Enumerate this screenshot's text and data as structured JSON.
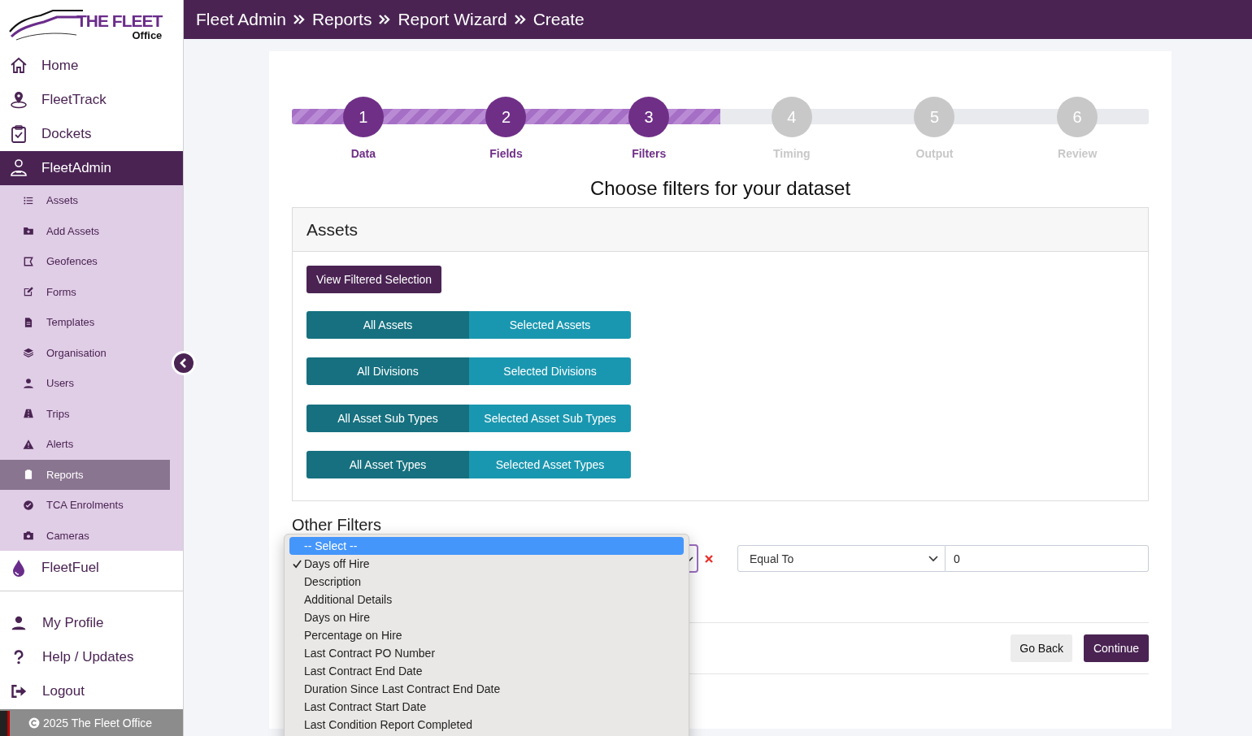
{
  "sidebar": {
    "logo": {
      "title": "THE FLEET",
      "subtitle": "Office"
    },
    "items": [
      {
        "label": "Home",
        "selected": false
      },
      {
        "label": "FleetTrack",
        "selected": false
      },
      {
        "label": "Dockets",
        "selected": false
      },
      {
        "label": "FleetAdmin",
        "selected": true,
        "expanded": true,
        "children": [
          {
            "label": "Assets",
            "selected": false
          },
          {
            "label": "Add Assets",
            "selected": false
          },
          {
            "label": "Geofences",
            "selected": false
          },
          {
            "label": "Forms",
            "selected": false
          },
          {
            "label": "Templates",
            "selected": false
          },
          {
            "label": "Organisation",
            "selected": false
          },
          {
            "label": "Users",
            "selected": false
          },
          {
            "label": "Trips",
            "selected": false
          },
          {
            "label": "Alerts",
            "selected": false
          },
          {
            "label": "Reports",
            "selected": true
          },
          {
            "label": "TCA Enrolments",
            "selected": false
          },
          {
            "label": "Cameras",
            "selected": false
          }
        ]
      },
      {
        "label": "FleetFuel",
        "selected": false
      }
    ],
    "account_items": [
      {
        "label": "My Profile"
      },
      {
        "label": "Help / Updates"
      },
      {
        "label": "Logout"
      }
    ],
    "footer": "2025 The Fleet Office"
  },
  "breadcrumb": [
    "Fleet Admin",
    "Reports",
    "Report Wizard",
    "Create"
  ],
  "wizard": {
    "level": 0.5,
    "steps": [
      {
        "number": "1",
        "label": "Data",
        "active": true
      },
      {
        "number": "2",
        "label": "Fields",
        "active": true
      },
      {
        "number": "3",
        "label": "Filters",
        "active": true
      },
      {
        "number": "4",
        "label": "Timing",
        "active": false
      },
      {
        "number": "5",
        "label": "Output",
        "active": false
      },
      {
        "number": "6",
        "label": "Review",
        "active": false
      }
    ]
  },
  "heading": "Choose filters for your dataset",
  "assets_panel": {
    "title": "Assets",
    "view_button": "View Filtered Selection",
    "toggles": [
      [
        {
          "label": "All Assets",
          "selected": true
        },
        {
          "label": "Selected Assets",
          "selected": false
        }
      ],
      [
        {
          "label": "All Divisions",
          "selected": true
        },
        {
          "label": "Selected Divisions",
          "selected": false
        }
      ],
      [
        {
          "label": "All Asset Sub Types",
          "selected": true
        },
        {
          "label": "Selected Asset Sub Types",
          "selected": false
        }
      ],
      [
        {
          "label": "All Asset Types",
          "selected": true
        },
        {
          "label": "Selected Asset Types",
          "selected": false
        }
      ]
    ]
  },
  "other_filters": {
    "title": "Other Filters",
    "operator": "Equal To",
    "value": "0",
    "dropdown": [
      {
        "label": "-- Select --",
        "highlighted": true,
        "checked": false
      },
      {
        "label": "Days off Hire",
        "highlighted": false,
        "checked": true
      },
      {
        "label": "Description",
        "highlighted": false,
        "checked": false
      },
      {
        "label": "Additional Details",
        "highlighted": false,
        "checked": false
      },
      {
        "label": "Days on Hire",
        "highlighted": false,
        "checked": false
      },
      {
        "label": "Percentage on Hire",
        "highlighted": false,
        "checked": false
      },
      {
        "label": "Last Contract PO Number",
        "highlighted": false,
        "checked": false
      },
      {
        "label": "Last Contract End Date",
        "highlighted": false,
        "checked": false
      },
      {
        "label": "Duration Since Last Contract End Date",
        "highlighted": false,
        "checked": false
      },
      {
        "label": "Last Contract Start Date",
        "highlighted": false,
        "checked": false
      },
      {
        "label": "Last Condition Report Completed",
        "highlighted": false,
        "checked": false
      }
    ]
  },
  "buttons": {
    "back": "Go Back",
    "next": "Continue"
  }
}
